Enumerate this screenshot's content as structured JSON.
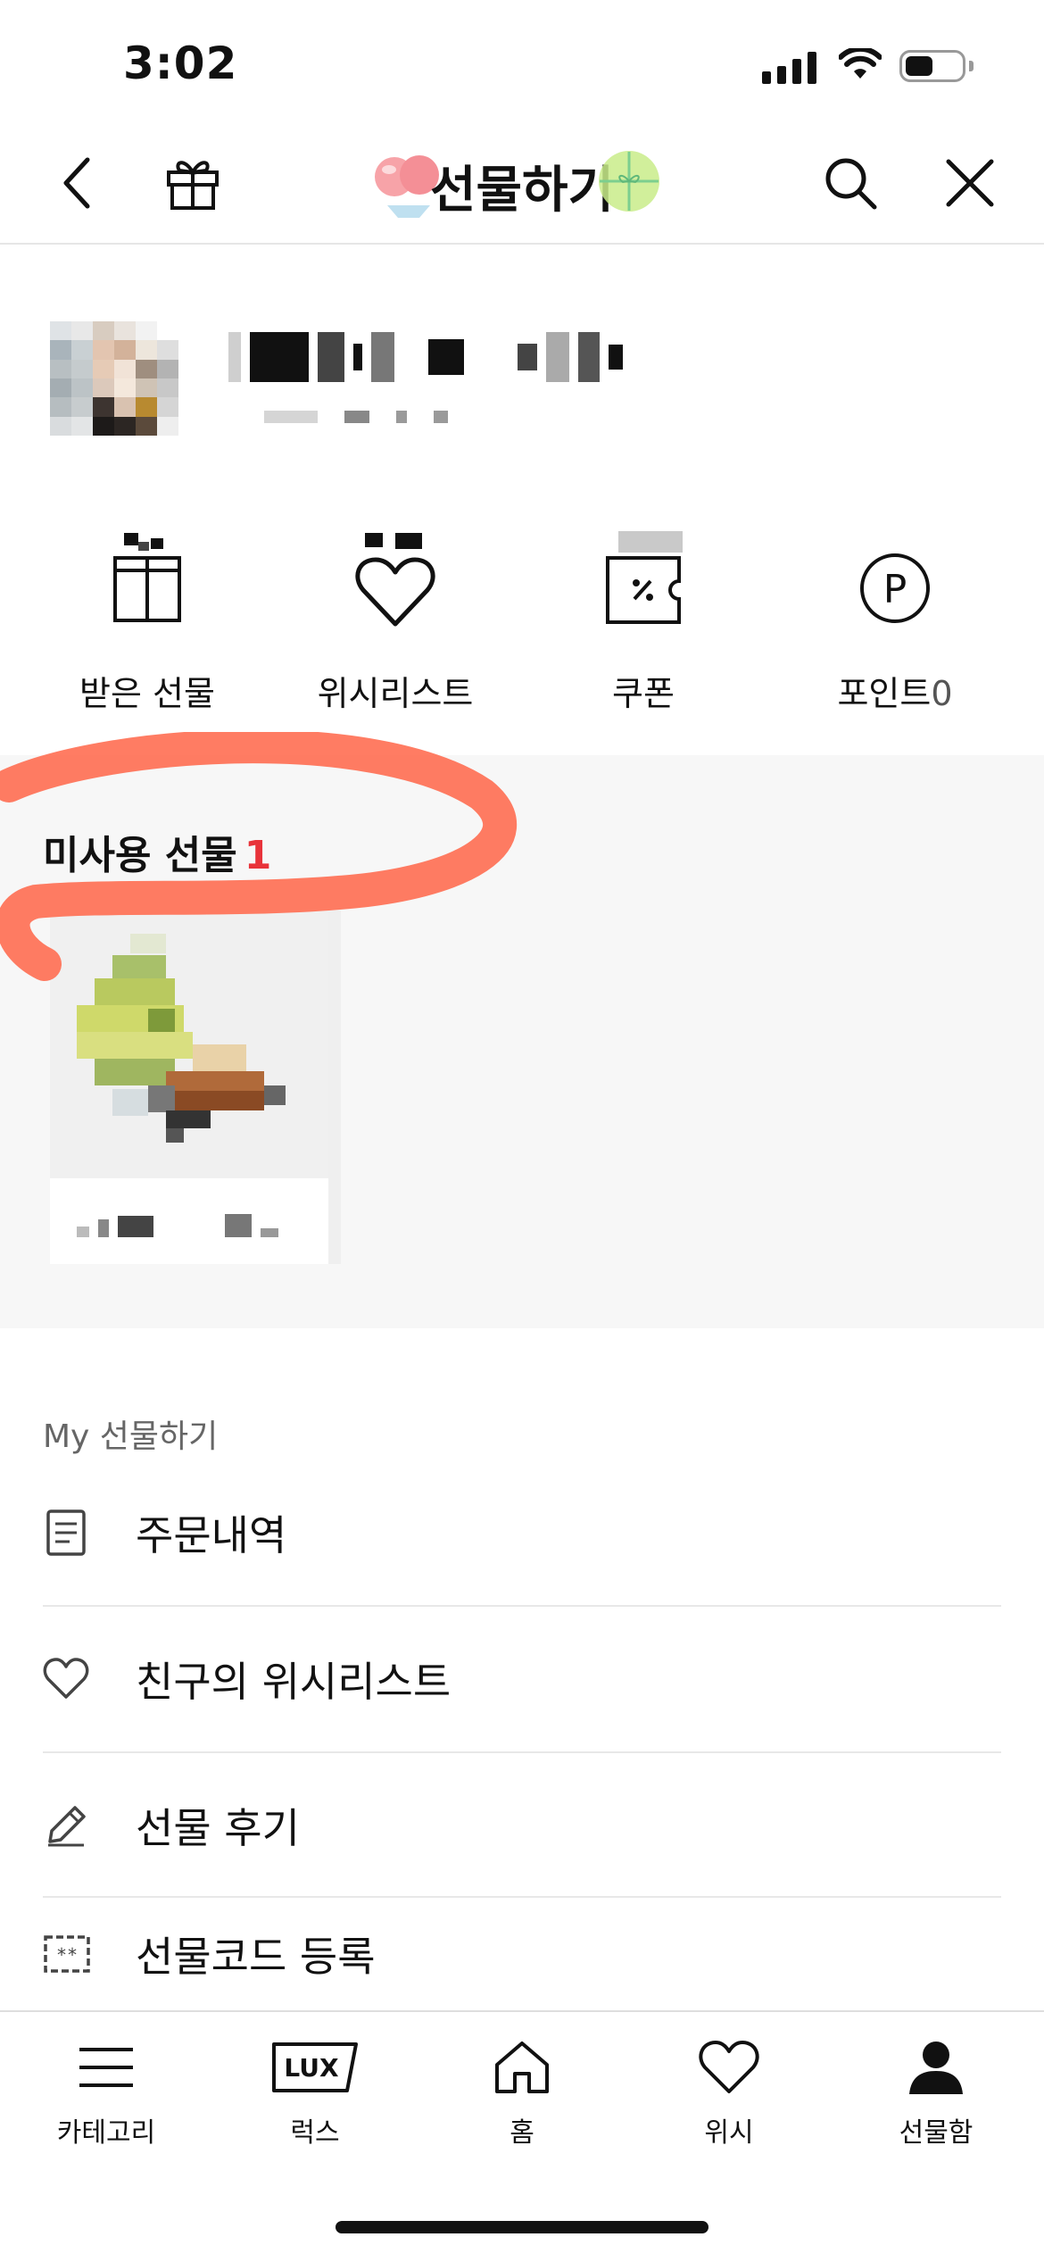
{
  "status_bar": {
    "time": "3:02"
  },
  "header": {
    "title": "선물하기",
    "icons": [
      "back-icon",
      "gift-icon",
      "search-icon",
      "close-icon"
    ]
  },
  "quick_menu": [
    {
      "label": "받은 선물",
      "icon": "gift-box-icon"
    },
    {
      "label": "위시리스트",
      "icon": "heart-icon"
    },
    {
      "label": "쿠폰",
      "icon": "coupon-icon"
    },
    {
      "label": "포인트",
      "count": "0",
      "icon": "point-icon"
    }
  ],
  "unused_gifts": {
    "title": "미사용 선물",
    "count": "1"
  },
  "my_section": {
    "title": "My 선물하기",
    "items": [
      {
        "label": "주문내역",
        "icon": "receipt-icon"
      },
      {
        "label": "친구의 위시리스트",
        "icon": "heart-outline-icon"
      },
      {
        "label": "선물 후기",
        "icon": "pencil-icon"
      },
      {
        "label": "선물코드 등록",
        "icon": "code-ticket-icon"
      }
    ]
  },
  "tab_bar": [
    {
      "label": "카테고리",
      "icon": "menu-icon"
    },
    {
      "label": "럭스",
      "icon": "lux-icon",
      "badge": "LUX"
    },
    {
      "label": "홈",
      "icon": "home-icon"
    },
    {
      "label": "위시",
      "icon": "heart-icon"
    },
    {
      "label": "선물함",
      "icon": "person-icon"
    }
  ],
  "colors": {
    "accent_red": "#e8333a",
    "section_bg": "#f7f7f7",
    "annotation_orange": "#ff6a4d"
  }
}
